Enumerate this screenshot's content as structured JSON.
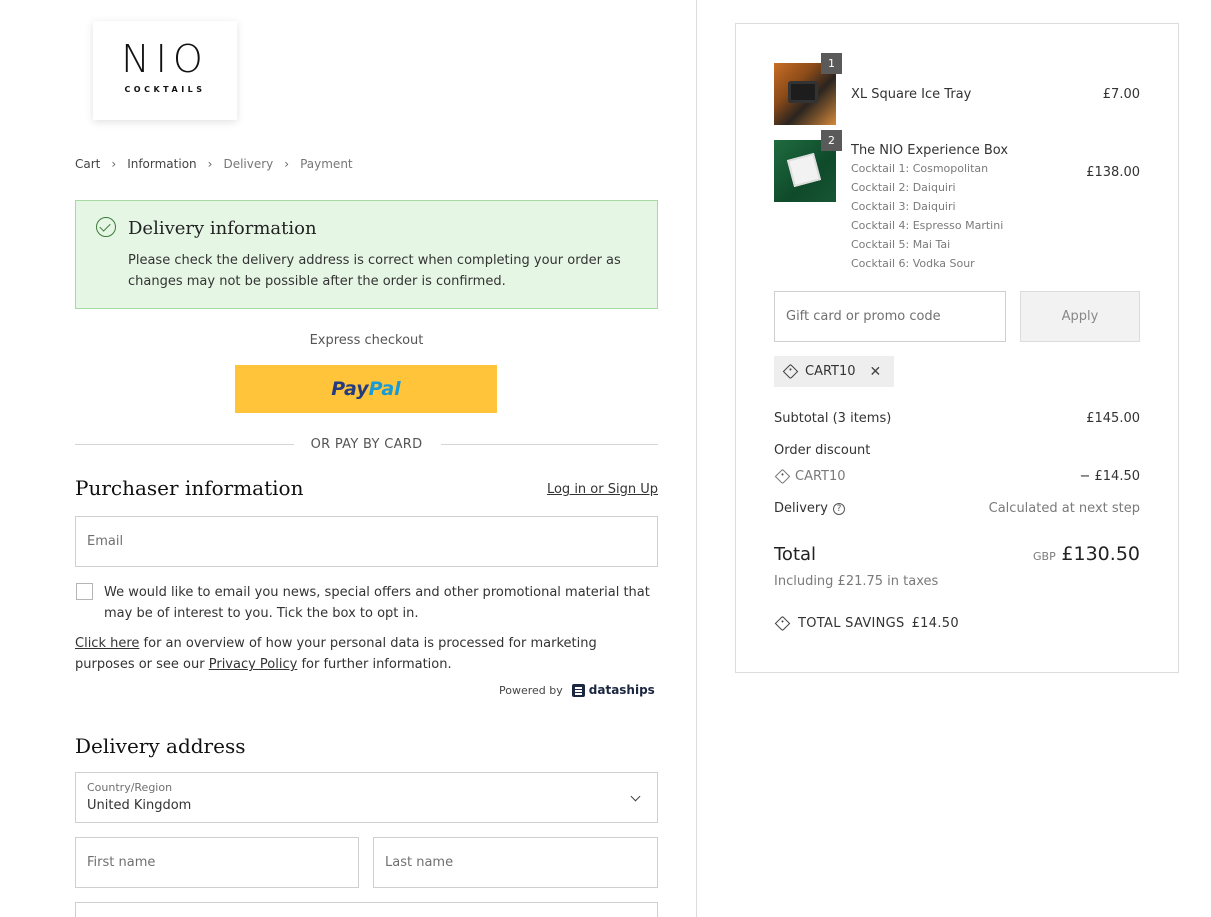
{
  "logo": {
    "main": "NIO",
    "sub": "COCKTAILS"
  },
  "breadcrumb": {
    "items": [
      "Cart",
      "Information",
      "Delivery",
      "Payment"
    ],
    "separator": "›"
  },
  "alert": {
    "title": "Delivery information",
    "text": "Please check the delivery address is correct when completing your order as changes may not be possible after the order is confirmed."
  },
  "express": {
    "label": "Express checkout",
    "paypal_part1": "Pay",
    "paypal_part2": "Pal"
  },
  "or_divider": "OR PAY BY CARD",
  "purchaser": {
    "title": "Purchaser information",
    "login_link": "Log in or Sign Up",
    "email_placeholder": "Email",
    "optin_text": "We would like to email you news, special offers and other promotional material that may be of interest to you. Tick the box to opt in.",
    "privacy_link1": "Click here",
    "privacy_mid": " for an overview of how your personal data is processed for marketing purposes or see our ",
    "privacy_link2": "Privacy Policy",
    "privacy_end": " for further information.",
    "powered_by": "Powered by",
    "powered_brand": "dataships"
  },
  "delivery": {
    "title": "Delivery address",
    "country_label": "Country/Region",
    "country_value": "United Kingdom",
    "first_name_placeholder": "First name",
    "last_name_placeholder": "Last name"
  },
  "summary": {
    "items": [
      {
        "qty": "1",
        "name": "XL Square Ice Tray",
        "price": "£7.00",
        "details": []
      },
      {
        "qty": "2",
        "name": "The NIO Experience Box",
        "price": "£138.00",
        "details": [
          "Cocktail 1: Cosmopolitan",
          "Cocktail 2: Daiquiri",
          "Cocktail 3: Daiquiri",
          "Cocktail 4: Espresso Martini",
          "Cocktail 5: Mai Tai",
          "Cocktail 6: Vodka Sour"
        ]
      }
    ],
    "promo_placeholder": "Gift card or promo code",
    "apply_label": "Apply",
    "applied_code": "CART10",
    "subtotal_label": "Subtotal (3 items)",
    "subtotal_value": "£145.00",
    "discount_label": "Order discount",
    "discount_code": "CART10",
    "discount_value": "− £14.50",
    "delivery_label": "Delivery",
    "delivery_value": "Calculated at next step",
    "total_label": "Total",
    "total_currency": "GBP",
    "total_value": "£130.50",
    "taxes": "Including £21.75 in taxes",
    "savings_label": "TOTAL SAVINGS",
    "savings_value": "£14.50"
  }
}
